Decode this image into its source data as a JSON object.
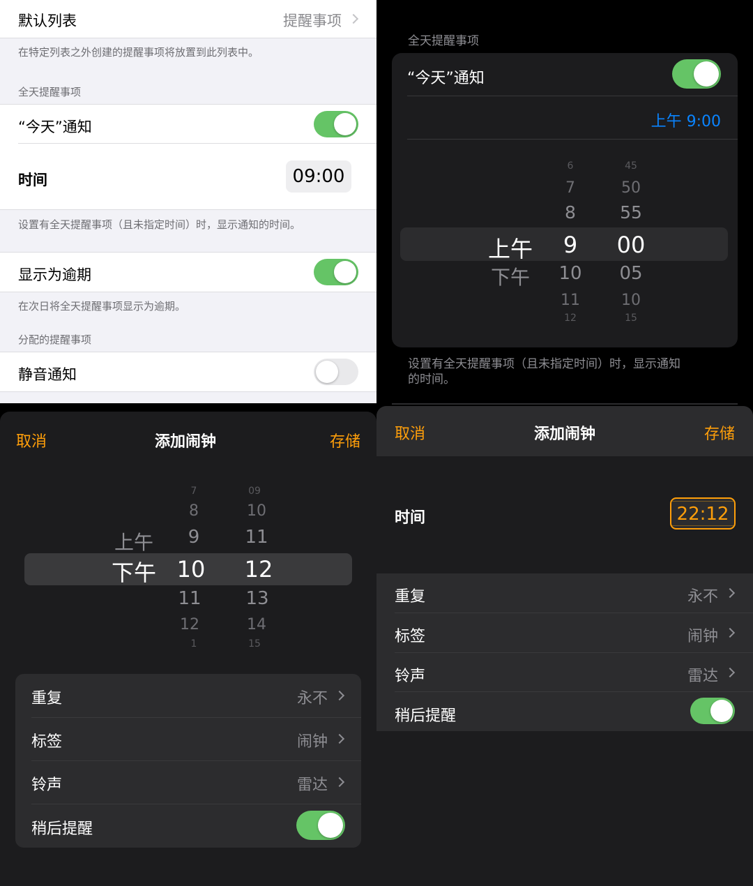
{
  "light_settings": {
    "default_list": {
      "label": "默认列表",
      "value": "提醒事项"
    },
    "default_list_caption": "在特定列表之外创建的提醒事项将放置到此列表中。",
    "all_day_header": "全天提醒事项",
    "today_notify": {
      "label": "“今天”通知",
      "on": true
    },
    "time": {
      "label": "时间",
      "value": "09:00"
    },
    "time_caption": "设置有全天提醒事项（且未指定时间）时，显示通知的时间。",
    "show_overdue": {
      "label": "显示为逾期",
      "on": true
    },
    "overdue_caption": "在次日将全天提醒事项显示为逾期。",
    "assigned_header": "分配的提醒事项",
    "mute_notify": {
      "label": "静音通知",
      "on": false
    }
  },
  "dark_reminder": {
    "header": "全天提醒事项",
    "today_notify": {
      "label": "“今天”通知",
      "on": true
    },
    "time_value": "上午 9:00",
    "picker": {
      "period": [
        "上午",
        "下午"
      ],
      "hours": [
        "6",
        "7",
        "8",
        "9",
        "10",
        "11",
        "12"
      ],
      "minutes": [
        "45",
        "50",
        "55",
        "00",
        "05",
        "10",
        "15"
      ]
    },
    "caption": "设置有全天提醒事项（且未指定时间）时，显示通知的时间。",
    "caption_line1": "设置有全天提醒事项（且未指定时间）时，显示通知",
    "caption_line2": "的时间。"
  },
  "alarm_picker": {
    "cancel": "取消",
    "title": "添加闹钟",
    "save": "存储",
    "picker": {
      "period": [
        "上午",
        "下午"
      ],
      "hours": [
        "7",
        "8",
        "9",
        "10",
        "11",
        "12",
        "1"
      ],
      "minutes": [
        "09",
        "10",
        "11",
        "12",
        "13",
        "14",
        "15"
      ]
    },
    "rows": [
      {
        "label": "重复",
        "value": "永不"
      },
      {
        "label": "标签",
        "value": "闹钟"
      },
      {
        "label": "铃声",
        "value": "雷达"
      }
    ],
    "snooze": {
      "label": "稍后提醒",
      "on": true
    }
  },
  "alarm_inline": {
    "cancel": "取消",
    "title": "添加闹钟",
    "save": "存储",
    "time_label": "时间",
    "time_value": "22:12",
    "rows": [
      {
        "label": "重复",
        "value": "永不"
      },
      {
        "label": "标签",
        "value": "闹钟"
      },
      {
        "label": "铃声",
        "value": "雷达"
      }
    ],
    "snooze": {
      "label": "稍后提醒",
      "on": true
    }
  },
  "colors": {
    "accent_orange": "#ff9f0a",
    "accent_blue": "#0a84ff",
    "toggle_green": "#65c466"
  }
}
